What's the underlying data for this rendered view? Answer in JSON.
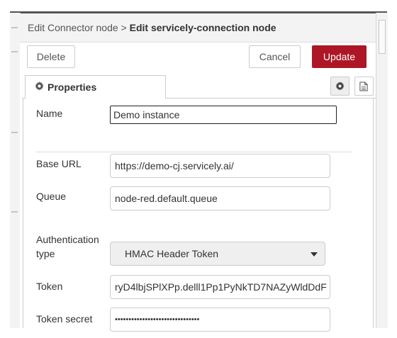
{
  "header": {
    "breadcrumb_parent": "Edit Connector node",
    "breadcrumb_separator": ">",
    "breadcrumb_current": "Edit servicely-connection node"
  },
  "toolbar": {
    "delete_label": "Delete",
    "cancel_label": "Cancel",
    "update_label": "Update",
    "update_color": "#ad1625"
  },
  "tabs": {
    "active_label": "Properties",
    "active_icon": "gear-icon",
    "buttons": [
      "settings-icon",
      "description-icon"
    ]
  },
  "form": {
    "name": {
      "label": "Name",
      "value": "Demo instance"
    },
    "base_url": {
      "label": "Base URL",
      "value": "https://demo-cj.servicely.ai/"
    },
    "queue": {
      "label": "Queue",
      "value": "node-red.default.queue"
    },
    "auth_type": {
      "label_line1": "Authentication",
      "label_line2": "type",
      "value": "HMAC Header Token"
    },
    "token": {
      "label": "Token",
      "value": "ryD4lbjSPlXPp.delll1Pp1PyNkTD7NAZyWldDdF"
    },
    "token_secret": {
      "label": "Token secret",
      "value": "•••••••••••••••••••••••••••••••"
    }
  }
}
